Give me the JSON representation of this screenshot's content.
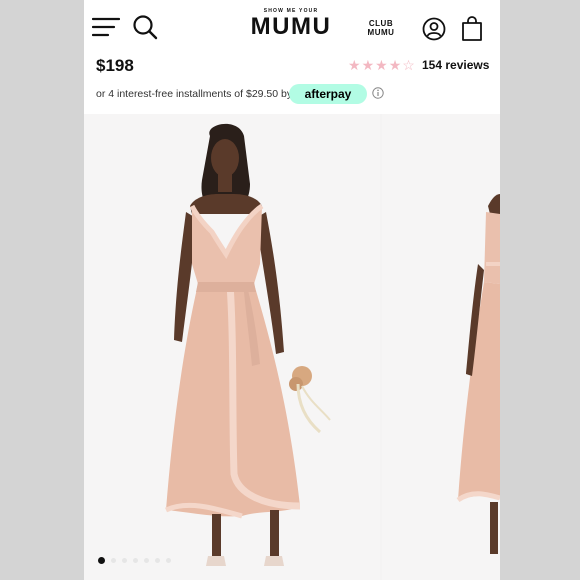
{
  "header": {
    "logo_tagline": "SHOW ME YOUR",
    "logo_name": "MUMU",
    "club_line1": "CLUB",
    "club_line2": "MUMU"
  },
  "product": {
    "price": "$198",
    "rating": 4,
    "rating_max": 5,
    "reviews": "154 reviews",
    "installments_text": "or 4 interest-free installments of $29.50 by",
    "afterpay_label": "afterpay"
  },
  "gallery": {
    "slide_count": 7,
    "active_slide": 1
  },
  "colors": {
    "star": "#f3b8c2",
    "afterpay_bg": "#b2fce4",
    "dress": "#eac0ad"
  }
}
